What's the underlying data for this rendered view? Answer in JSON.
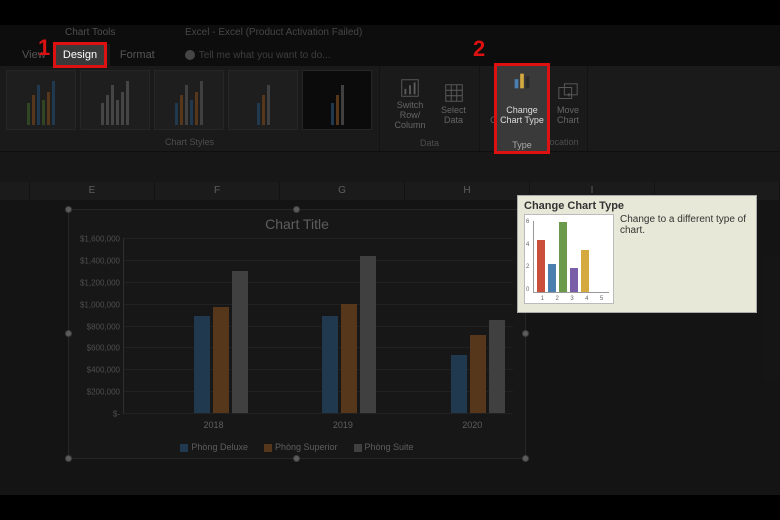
{
  "window": {
    "tools_context": "Chart Tools",
    "title": "Excel - Excel (Product Activation Failed)"
  },
  "tabs": {
    "view": "View",
    "design": "Design",
    "format": "Format",
    "tellme_placeholder": "Tell me what you want to do..."
  },
  "ribbon": {
    "chart_styles_label": "Chart Styles",
    "data_label": "Data",
    "type_label": "Type",
    "location_label": "Location",
    "switch_row": "Switch Row/\nColumn",
    "select_data": "Select\nData",
    "change_chart_type": "Change\nChart Type",
    "move_chart": "Move\nChart"
  },
  "callouts": {
    "one": "1",
    "two": "2"
  },
  "columns": [
    "E",
    "F",
    "G",
    "H",
    "I"
  ],
  "tooltip": {
    "title": "Change Chart Type",
    "desc": "Change to a different type of chart."
  },
  "chart_data": {
    "type": "bar",
    "title": "Chart Title",
    "ylabel": "",
    "xlabel": "",
    "ylim": [
      0,
      1600000
    ],
    "y_ticks": [
      "$1,600,000",
      "$1,400,000",
      "$1,200,000",
      "$1,000,000",
      "$800,000",
      "$600,000",
      "$400,000",
      "$200,000",
      "$-"
    ],
    "categories": [
      "2018",
      "2019",
      "2020"
    ],
    "series": [
      {
        "name": "Phòng Deluxe",
        "color": "#4a7fb0",
        "values": [
          870000,
          870000,
          520000
        ]
      },
      {
        "name": "Phòng Superior",
        "color": "#c07a3f",
        "values": [
          950000,
          980000,
          700000
        ]
      },
      {
        "name": "Phòng Suite",
        "color": "#8f8f8f",
        "values": [
          1280000,
          1410000,
          840000
        ]
      }
    ]
  },
  "mini_chart": {
    "x": [
      "1",
      "2",
      "3",
      "4",
      "5"
    ],
    "y": [
      "6",
      "4",
      "2",
      "0"
    ],
    "bars": [
      {
        "h": 52,
        "c": "#c94f3a"
      },
      {
        "h": 28,
        "c": "#4a7fb0"
      },
      {
        "h": 70,
        "c": "#6a9a4a"
      },
      {
        "h": 24,
        "c": "#7a5fa8"
      },
      {
        "h": 42,
        "c": "#d4a93f"
      }
    ]
  }
}
